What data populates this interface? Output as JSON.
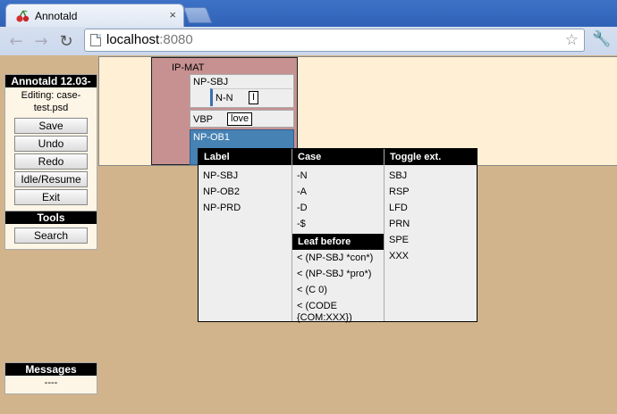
{
  "browser": {
    "tab_title": "Annotald",
    "tab_close": "×",
    "url_host": "localhost",
    "url_port": ":8080",
    "back_icon": "back-arrow-icon",
    "forward_icon": "forward-arrow-icon",
    "reload_icon": "reload-icon",
    "star_icon": "bookmark-star-icon",
    "wrench_icon": "wrench-icon"
  },
  "sidebar": {
    "title": "Annotald 12.03-",
    "editing": "Editing: case-test.psd",
    "buttons": [
      "Save",
      "Undo",
      "Redo",
      "Idle/Resume",
      "Exit"
    ]
  },
  "tools": {
    "title": "Tools",
    "search_label": "Search"
  },
  "messages": {
    "title": "Messages",
    "body": "----"
  },
  "tree": {
    "root_label": "IP-MAT",
    "np_sbj_label": "NP-SBJ",
    "nn_label": "N-N",
    "nn_word": "I",
    "vbp_label": "VBP",
    "vbp_word": "love",
    "np_ob1_label": "NP-OB1"
  },
  "context_menu": {
    "label_header": "Label",
    "labels": [
      "NP-SBJ",
      "NP-OB2",
      "NP-PRD"
    ],
    "case_header": "Case",
    "cases": [
      "-N",
      "-A",
      "-D",
      "-$"
    ],
    "leaf_before_header": "Leaf before",
    "leaf_before": [
      "< (NP-SBJ *con*)",
      "< (NP-SBJ *pro*)",
      "< (C 0)",
      "< (CODE {COM:XXX})"
    ],
    "toggle_header": "Toggle ext.",
    "toggles": [
      "SBJ",
      "RSP",
      "LFD",
      "PRN",
      "SPE",
      "XXX"
    ]
  },
  "colors": {
    "page_bg": "#d2b48c",
    "edit_pane_bg": "#ffefd5",
    "ip_node": "#c79191",
    "selected_node": "#4682b4",
    "menu_bg": "#eeeeee"
  }
}
